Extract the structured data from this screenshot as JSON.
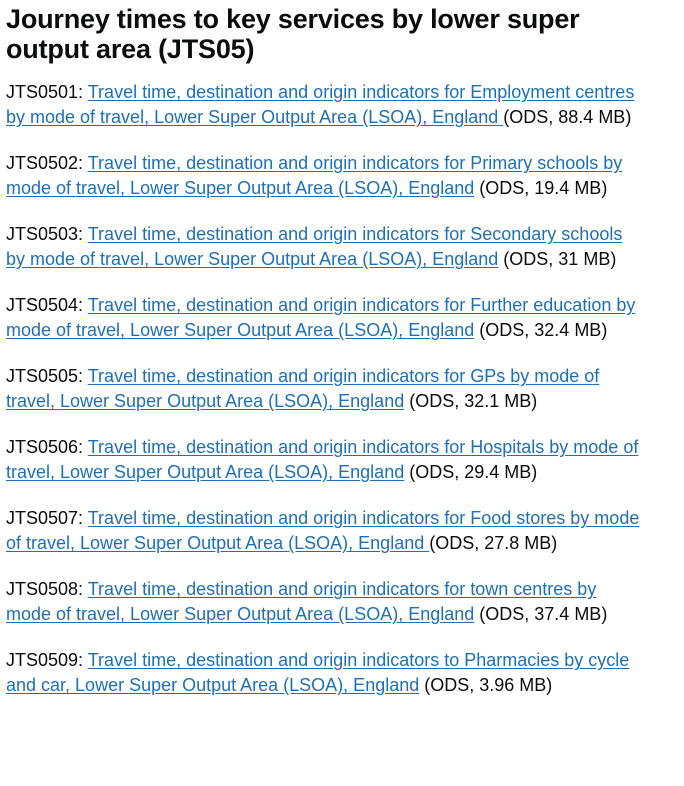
{
  "heading": "Journey times to key services by lower super output area (JTS05)",
  "entries": [
    {
      "code": "JTS0501",
      "link": "Travel time, destination and origin indicators for Employment centres by mode of travel, Lower Super Output Area (LSOA), England ",
      "meta": "(ODS, 88.4 MB)"
    },
    {
      "code": "JTS0502",
      "link": "Travel time, destination and origin indicators for Primary schools by mode of travel, Lower Super Output Area (LSOA), England",
      "meta": "(ODS, 19.4 MB)"
    },
    {
      "code": "JTS0503",
      "link": "Travel time, destination and origin indicators for Secondary schools by mode of travel, Lower Super Output Area (LSOA), England",
      "meta": "(ODS, 31 MB)"
    },
    {
      "code": "JTS0504",
      "link": "Travel time, destination and origin indicators for Further education by mode of travel, Lower Super Output Area (LSOA), England",
      "meta": "(ODS, 32.4 MB)"
    },
    {
      "code": "JTS0505",
      "link": "Travel time, destination and origin indicators for GPs by mode of travel, Lower Super Output Area (LSOA), England",
      "meta": "(ODS, 32.1 MB)"
    },
    {
      "code": "JTS0506",
      "link": "Travel time, destination and origin indicators for Hospitals by mode of travel, Lower Super Output Area (LSOA), England",
      "meta": "(ODS, 29.4 MB)"
    },
    {
      "code": "JTS0507",
      "link": "Travel time, destination and origin indicators for Food stores by mode of travel, Lower Super Output Area (LSOA), England ",
      "meta": "(ODS, 27.8 MB)"
    },
    {
      "code": "JTS0508",
      "link": "Travel time, destination and origin indicators for town centres by mode of travel, Lower Super Output Area (LSOA), England",
      "meta": "(ODS, 37.4 MB)"
    },
    {
      "code": "JTS0509",
      "link": "Travel time, destination and origin indicators to Pharmacies by cycle and car, Lower Super Output Area (LSOA), England",
      "meta": "(ODS, 3.96 MB)"
    }
  ],
  "colors": {
    "text": "#0b0c0c",
    "link": "#1d70b8"
  }
}
